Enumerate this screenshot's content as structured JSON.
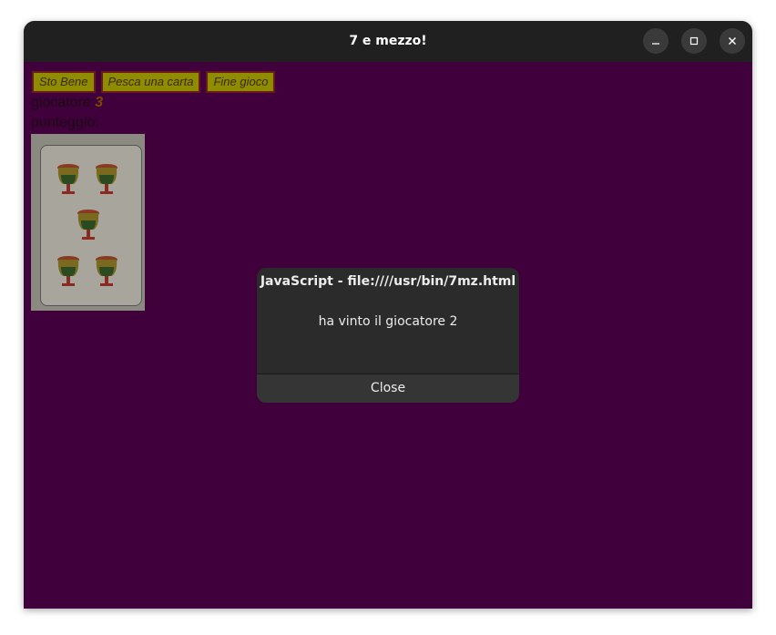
{
  "window": {
    "title": "7 e mezzo!",
    "minimize_icon": "minimize-icon",
    "maximize_icon": "maximize-icon",
    "close_icon": "close-icon"
  },
  "toolbar": {
    "buttons": [
      {
        "label": "Sto Bene"
      },
      {
        "label": "Pesca una carta"
      },
      {
        "label": "Fine gioco"
      }
    ]
  },
  "game": {
    "player_label": "giocatore:",
    "player_number": "3",
    "score_label": "punteggio:",
    "card": {
      "suit": "coppe",
      "rank": "5"
    }
  },
  "dialog": {
    "title": "JavaScript - file:////usr/bin/7mz.html",
    "message": "ha vinto il giocatore 2",
    "close_label": "Close"
  },
  "colors": {
    "background": "#40003c",
    "button_bg": "#8f8c00",
    "button_border": "#6b1a1a",
    "dialog_bg": "#2b2b2b"
  }
}
